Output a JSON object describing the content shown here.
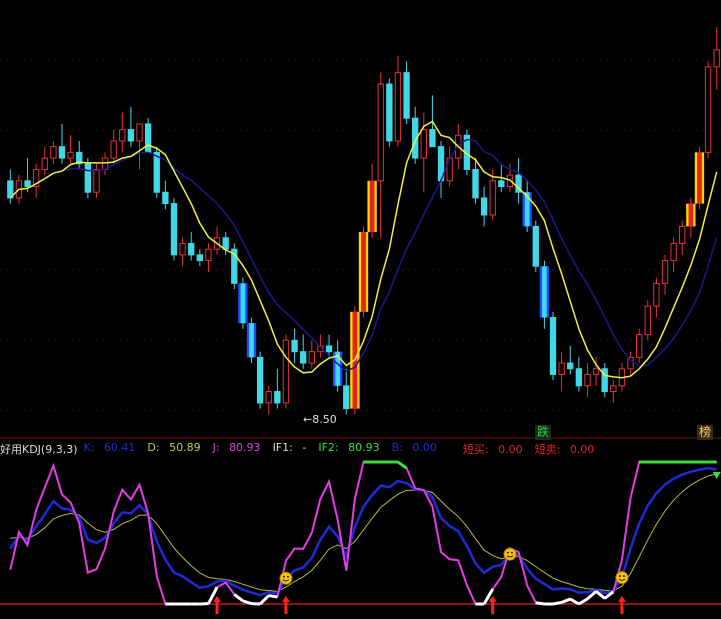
{
  "chart_data": {
    "type": "candlestick",
    "price_panel": {
      "low_annotation": "8.50",
      "badges": [
        {
          "text": "跌",
          "color": "#2ecc40",
          "bg": "#1c2b1c"
        },
        {
          "text": "榜",
          "color": "#ffcc66",
          "bg": "#3a2a14"
        }
      ]
    },
    "kdj_panel": {
      "title": "好用KDJ(9,3,3)",
      "fields": [
        {
          "label": "K:",
          "value": "60.41",
          "color": "#1f2bd6"
        },
        {
          "label": "D:",
          "value": "50.89",
          "color": "#c8c84a"
        },
        {
          "label": "J:",
          "value": "80.93",
          "color": "#e23ee2"
        },
        {
          "label": "IF1:",
          "value": "-",
          "color": "#dddddd"
        },
        {
          "label": "IF2:",
          "value": "80.93",
          "color": "#3ddc3d"
        },
        {
          "label": "B:",
          "value": "0.00",
          "color": "#1f2bd6"
        },
        {
          "label": "短买:",
          "value": "0.00",
          "color": "#e02020"
        },
        {
          "label": "短卖:",
          "value": "0.00",
          "color": "#e02020"
        }
      ]
    },
    "colors": {
      "up": "#e8303a",
      "down": "#40d8e8",
      "ma_fast": "#f0f040",
      "ma_slow": "#1a1a8a",
      "j_line": "#e23ee2",
      "k_line": "#1f2bd6",
      "d_line": "#b8b840",
      "buy_signal": "#3ddc3d",
      "low_zone": "#ffffff",
      "grid": "#7a1010"
    },
    "candles": [
      [
        10.6,
        10.8,
        10.2,
        10.3
      ],
      [
        10.3,
        10.7,
        10.2,
        10.6
      ],
      [
        10.6,
        11.0,
        10.4,
        10.5
      ],
      [
        10.5,
        10.9,
        10.3,
        10.8
      ],
      [
        10.8,
        11.2,
        10.7,
        11.0
      ],
      [
        11.0,
        11.3,
        10.9,
        11.2
      ],
      [
        11.2,
        11.6,
        10.9,
        11.0
      ],
      [
        11.0,
        11.4,
        10.9,
        11.1
      ],
      [
        11.1,
        11.3,
        10.8,
        10.9
      ],
      [
        10.9,
        11.0,
        10.3,
        10.4
      ],
      [
        10.4,
        10.9,
        10.3,
        10.8
      ],
      [
        10.8,
        11.1,
        10.7,
        11.0
      ],
      [
        11.0,
        11.5,
        10.9,
        11.3
      ],
      [
        11.3,
        11.8,
        11.1,
        11.5
      ],
      [
        11.5,
        11.9,
        11.2,
        11.3
      ],
      [
        11.3,
        11.6,
        10.8,
        11.6
      ],
      [
        11.6,
        11.7,
        11.2,
        11.1
      ],
      [
        11.1,
        11.2,
        10.3,
        10.4
      ],
      [
        10.4,
        10.6,
        10.1,
        10.2
      ],
      [
        10.2,
        10.3,
        9.2,
        9.3
      ],
      [
        9.3,
        9.6,
        9.1,
        9.5
      ],
      [
        9.5,
        9.7,
        9.2,
        9.3
      ],
      [
        9.3,
        9.4,
        9.1,
        9.2
      ],
      [
        9.2,
        9.5,
        9.0,
        9.4
      ],
      [
        9.4,
        9.8,
        9.3,
        9.6
      ],
      [
        9.6,
        9.7,
        9.3,
        9.4
      ],
      [
        9.4,
        9.5,
        8.7,
        8.8
      ],
      [
        8.8,
        8.9,
        8.0,
        8.1
      ],
      [
        8.1,
        8.2,
        7.4,
        7.5
      ],
      [
        7.5,
        7.6,
        6.6,
        6.7
      ],
      [
        6.7,
        7.0,
        6.5,
        6.9
      ],
      [
        6.9,
        7.3,
        6.6,
        6.7
      ],
      [
        6.7,
        7.9,
        6.6,
        7.8
      ],
      [
        7.8,
        8.0,
        7.4,
        7.6
      ],
      [
        7.6,
        7.9,
        7.3,
        7.4
      ],
      [
        7.4,
        7.8,
        7.3,
        7.6
      ],
      [
        7.6,
        7.9,
        7.5,
        7.7
      ],
      [
        7.7,
        7.9,
        7.5,
        7.6
      ],
      [
        7.6,
        7.8,
        6.9,
        7.0
      ],
      [
        7.0,
        7.3,
        6.5,
        6.6
      ],
      [
        6.6,
        8.4,
        6.5,
        8.3
      ],
      [
        8.3,
        9.8,
        8.2,
        9.7
      ],
      [
        9.7,
        10.9,
        9.6,
        10.6
      ],
      [
        10.6,
        12.5,
        9.6,
        12.3
      ],
      [
        12.3,
        12.4,
        11.2,
        11.3
      ],
      [
        11.3,
        12.8,
        11.2,
        12.5
      ],
      [
        12.5,
        12.7,
        11.6,
        11.7
      ],
      [
        11.7,
        11.9,
        10.9,
        11.0
      ],
      [
        11.0,
        11.8,
        10.4,
        11.5
      ],
      [
        11.5,
        12.1,
        11.2,
        11.2
      ],
      [
        11.2,
        11.3,
        10.3,
        10.6
      ],
      [
        10.6,
        11.2,
        10.5,
        11.0
      ],
      [
        11.0,
        11.6,
        10.8,
        11.4
      ],
      [
        11.4,
        11.5,
        10.7,
        10.8
      ],
      [
        10.8,
        11.0,
        10.2,
        10.3
      ],
      [
        10.3,
        10.5,
        9.8,
        10.0
      ],
      [
        10.0,
        10.8,
        9.9,
        10.6
      ],
      [
        10.6,
        10.9,
        10.4,
        10.5
      ],
      [
        10.5,
        10.9,
        10.4,
        10.7
      ],
      [
        10.7,
        11.0,
        10.2,
        10.4
      ],
      [
        10.4,
        10.6,
        9.7,
        9.8
      ],
      [
        9.8,
        9.9,
        9.0,
        9.1
      ],
      [
        9.1,
        9.2,
        8.0,
        8.2
      ],
      [
        8.2,
        8.3,
        7.1,
        7.2
      ],
      [
        7.2,
        7.6,
        6.9,
        7.4
      ],
      [
        7.4,
        7.7,
        7.2,
        7.3
      ],
      [
        7.3,
        7.5,
        6.9,
        7.0
      ],
      [
        7.0,
        7.4,
        6.8,
        7.2
      ],
      [
        7.2,
        7.5,
        7.0,
        7.3
      ],
      [
        7.3,
        7.4,
        6.8,
        6.9
      ],
      [
        6.9,
        7.1,
        6.7,
        7.0
      ],
      [
        7.0,
        7.4,
        6.9,
        7.3
      ],
      [
        7.3,
        7.6,
        7.2,
        7.5
      ],
      [
        7.5,
        8.0,
        7.4,
        7.9
      ],
      [
        7.9,
        8.5,
        7.8,
        8.4
      ],
      [
        8.4,
        8.9,
        8.2,
        8.8
      ],
      [
        8.8,
        9.3,
        8.6,
        9.2
      ],
      [
        9.2,
        9.6,
        9.0,
        9.5
      ],
      [
        9.5,
        9.9,
        9.3,
        9.8
      ],
      [
        9.8,
        10.3,
        9.6,
        10.2
      ],
      [
        10.2,
        11.2,
        10.1,
        11.1
      ],
      [
        11.1,
        12.7,
        11.0,
        12.6
      ],
      [
        12.6,
        13.3,
        12.2,
        12.9
      ]
    ],
    "signal_candles": [
      27,
      28,
      38,
      40,
      41,
      42,
      60,
      62,
      79,
      80
    ]
  }
}
